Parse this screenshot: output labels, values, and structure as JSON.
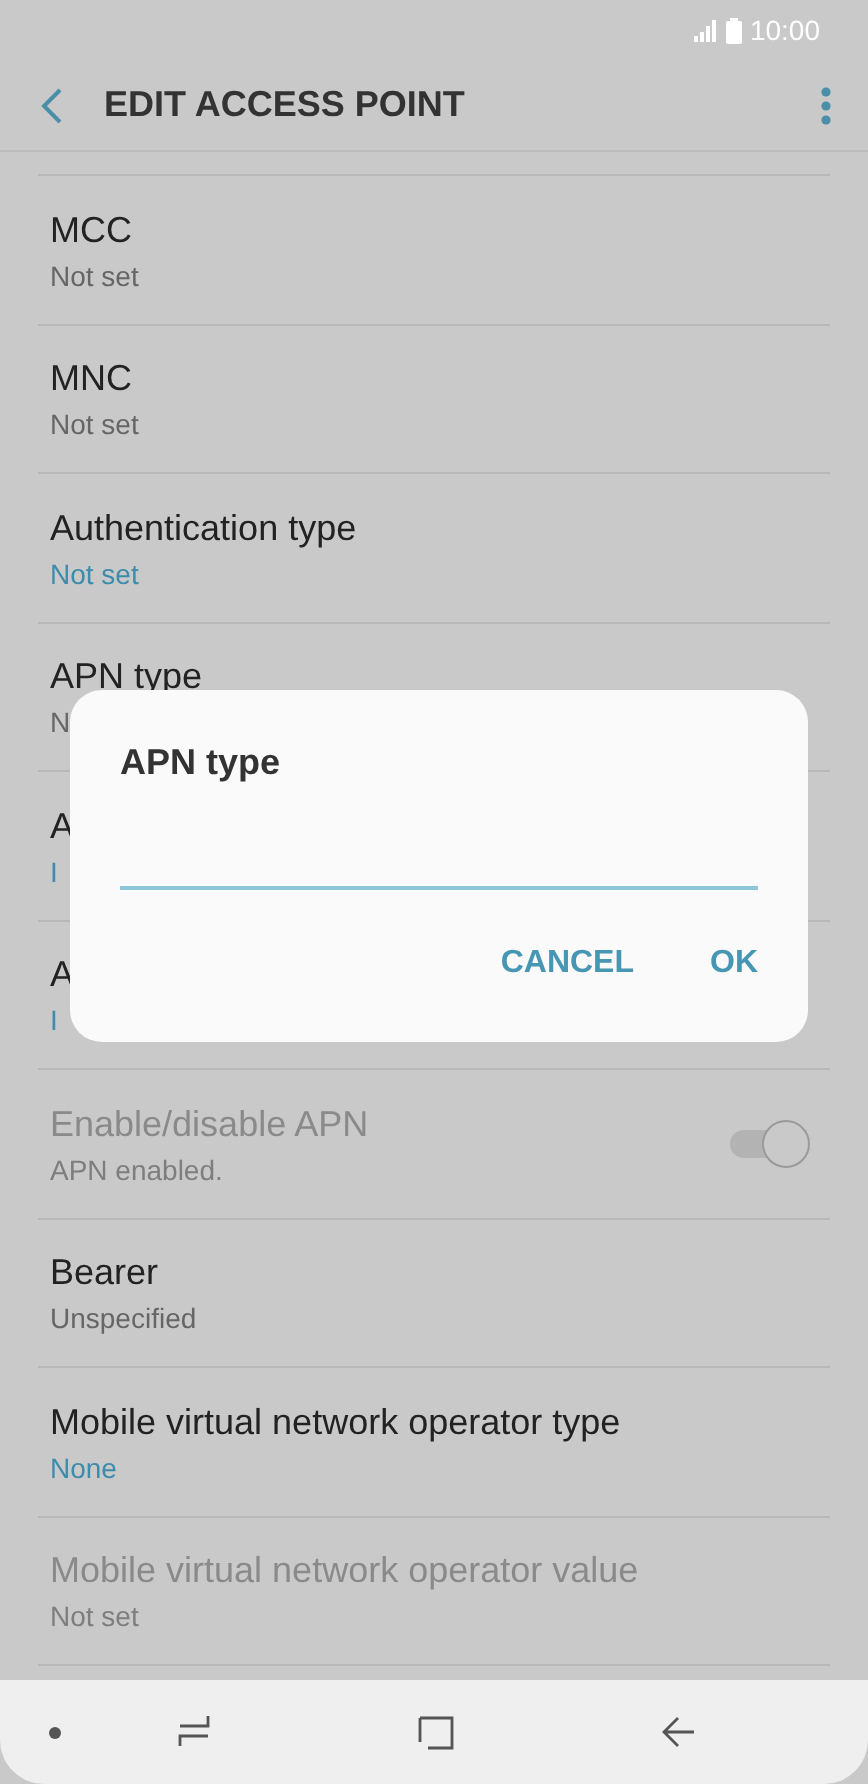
{
  "status_bar": {
    "time": "10:00"
  },
  "app_bar": {
    "title": "EDIT ACCESS POINT"
  },
  "settings": [
    {
      "kind": "text",
      "title": "MCC",
      "value": "Not set",
      "accent": false,
      "disabled": false
    },
    {
      "kind": "text",
      "title": "MNC",
      "value": "Not set",
      "accent": false,
      "disabled": false
    },
    {
      "kind": "text",
      "title": "Authentication type",
      "value": "Not set",
      "accent": true,
      "disabled": false
    },
    {
      "kind": "text",
      "title": "APN type",
      "value": "N",
      "accent": false,
      "disabled": false
    },
    {
      "kind": "text",
      "title": "A",
      "value": "I",
      "accent": true,
      "disabled": false
    },
    {
      "kind": "text",
      "title": "A",
      "value": "I",
      "accent": true,
      "disabled": false
    },
    {
      "kind": "toggle",
      "title": "Enable/disable APN",
      "value": "APN enabled.",
      "accent": false,
      "disabled": true,
      "on": true
    },
    {
      "kind": "text",
      "title": "Bearer",
      "value": "Unspecified",
      "accent": false,
      "disabled": false
    },
    {
      "kind": "text",
      "title": "Mobile virtual network operator type",
      "value": "None",
      "accent": true,
      "disabled": false
    },
    {
      "kind": "text",
      "title": "Mobile virtual network operator value",
      "value": "Not set",
      "accent": false,
      "disabled": true
    }
  ],
  "dialog": {
    "title": "APN type",
    "buttons": [
      "CANCEL",
      "OK"
    ]
  }
}
